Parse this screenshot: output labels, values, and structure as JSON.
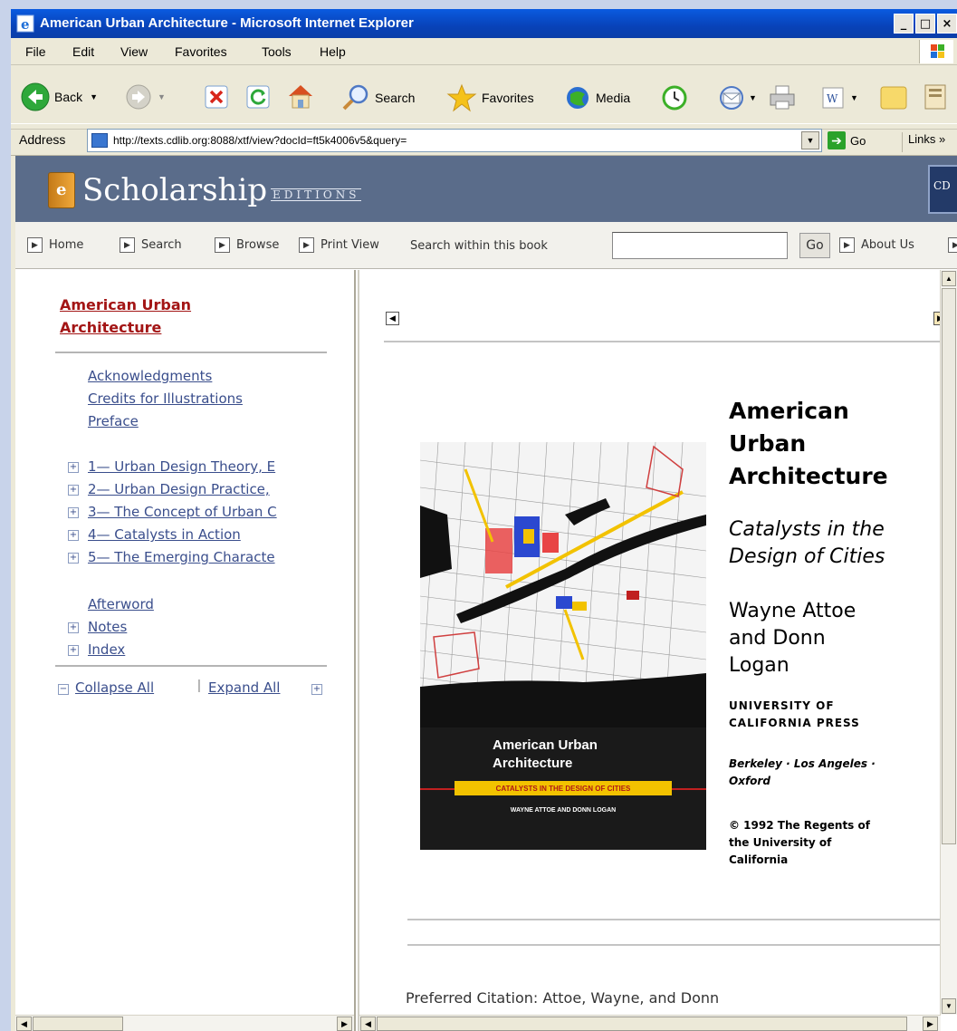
{
  "window": {
    "title": "American Urban Architecture - Microsoft Internet Explorer",
    "min": "_",
    "max": "□",
    "close": "×"
  },
  "menu": [
    "File",
    "Edit",
    "View",
    "Favorites",
    "Tools",
    "Help"
  ],
  "toolbar": {
    "back": "Back",
    "search": "Search",
    "favorites": "Favorites",
    "media": "Media"
  },
  "address": {
    "label": "Address",
    "url": "http://texts.cdlib.org:8088/xtf/view?docId=ft5k4006v5&query=",
    "go": "Go",
    "links": "Links »"
  },
  "site": {
    "brand": "Scholarship",
    "editions": "EDITIONS",
    "book_letter": "e",
    "cdl": "CD"
  },
  "nav": {
    "home": "Home",
    "search": "Search",
    "browse": "Browse",
    "print_view": "Print View",
    "search_within": "Search within this book",
    "search_placeholder": "",
    "go": "Go",
    "about": "About Us"
  },
  "toc": {
    "title_line1": "American Urban",
    "title_line2": "Architecture",
    "front": [
      "Acknowledgments",
      "Credits for Illustrations",
      "Preface"
    ],
    "chapters": [
      "1— Urban Design Theory, E",
      "2— Urban Design Practice,",
      "3— The Concept of Urban C",
      "4— Catalysts in Action",
      "5— The Emerging Characte"
    ],
    "afterword": "Afterword",
    "notes": "Notes",
    "index": "Index",
    "collapse": "Collapse All",
    "separator": "|",
    "expand": "Expand All"
  },
  "book": {
    "title_lines": [
      "American",
      "Urban",
      "Architecture"
    ],
    "subtitle_lines": [
      "Catalysts in the",
      "Design of Cities"
    ],
    "author_lines": [
      "Wayne Attoe",
      "and Donn",
      "Logan"
    ],
    "press_lines": [
      "UNIVERSITY OF",
      "CALIFORNIA PRESS"
    ],
    "city_lines": [
      "Berkeley · Los Angeles ·",
      "Oxford"
    ],
    "copyright_lines": [
      "© 1992 The Regents of",
      "the University of",
      "California"
    ],
    "cover_title_lines": [
      "American Urban",
      "Architecture"
    ],
    "cover_strip": "CATALYSTS IN THE DESIGN OF CITIES",
    "cover_authors": "WAYNE ATTOE AND DONN LOGAN"
  },
  "citation": "Preferred Citation: Attoe, Wayne, and Donn",
  "colors": {
    "titlebar": "#0842b8",
    "banner": "#5a6c8a",
    "toc_title": "#a31515",
    "toc_link": "#3a4e8c"
  },
  "icons": [
    "ie-icon",
    "back-icon",
    "forward-icon",
    "stop-icon",
    "refresh-icon",
    "home-icon",
    "search-icon",
    "favorites-icon",
    "media-icon",
    "history-icon",
    "mail-icon",
    "print-icon",
    "edit-icon",
    "folder-icon",
    "page-icon",
    "go-arrow-icon"
  ]
}
